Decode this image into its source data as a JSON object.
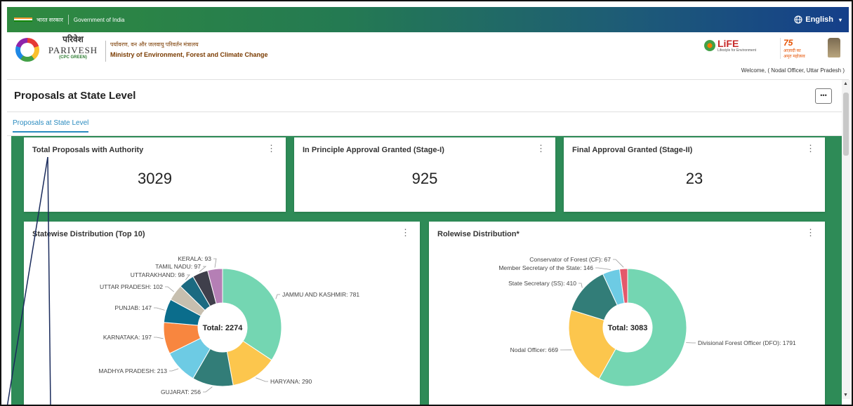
{
  "gov_bar": {
    "hindi_label": "भारत सरकार",
    "label": "Government of India",
    "language": "English",
    "colors": {
      "flag_saffron": "#ff9933",
      "flag_white": "#ffffff",
      "flag_green": "#138808"
    }
  },
  "header": {
    "brand_hindi": "परिवेश",
    "brand_name": "PARIVESH",
    "brand_sub": "(CPC GREEN)",
    "ministry_hindi": "पर्यावरण, वन और जलवायु परिवर्तन मंत्रालय",
    "ministry_name": "Ministry of Environment, Forest and Climate Change",
    "life_logo_text": "LiFE",
    "life_logo_sub": "Lifestyle for Environment",
    "azadi_text": "75",
    "azadi_sub": "आज़ादी का अमृत महोत्सव",
    "welcome": "Welcome, ( Nodal Officer, Uttar Pradesh )"
  },
  "page": {
    "title": "Proposals at State Level",
    "more_icon": "ellipsis-icon",
    "tabs": [
      {
        "label": "Proposals at State Level",
        "active": true
      }
    ]
  },
  "stats": [
    {
      "title": "Total Proposals with Authority",
      "value": "3029"
    },
    {
      "title": "In Principle Approval Granted (Stage-I)",
      "value": "925"
    },
    {
      "title": "Final Approval Granted (Stage-II)",
      "value": "23"
    }
  ],
  "charts": {
    "statewise_title": "Statewise Distribution (Top 10)",
    "rolewise_title": "Rolewise Distribution*"
  },
  "chart_data": [
    {
      "type": "pie",
      "title": "Statewise Distribution (Top 10)",
      "center_label": "Total: 2274",
      "total": 2274,
      "categories": [
        "JAMMU AND KASHMIR",
        "HARYANA",
        "GUJARAT",
        "MADHYA PRADESH",
        "KARNATAKA",
        "PUNJAB",
        "UTTAR PRADESH",
        "UTTARAKHAND",
        "TAMIL NADU",
        "KERALA"
      ],
      "values": [
        781,
        290,
        256,
        213,
        197,
        147,
        102,
        98,
        97,
        93
      ],
      "colors": [
        "#74d6b2",
        "#fcc64d",
        "#327d78",
        "#6dcbe4",
        "#f8863f",
        "#0b6d8c",
        "#c7bfaf",
        "#1b6a81",
        "#3f3f4b",
        "#b57fb5"
      ],
      "labels": [
        "JAMMU AND KASHMIR: 781",
        "HARYANA: 290",
        "GUJARAT: 256",
        "MADHYA PRADESH: 213",
        "KARNATAKA: 197",
        "PUNJAB: 147",
        "UTTAR PRADESH: 102",
        "UTTARAKHAND: 98",
        "TAMIL NADU: 97",
        "KERALA: 93"
      ]
    },
    {
      "type": "pie",
      "title": "Rolewise Distribution*",
      "center_label": "Total: 3083",
      "total": 3083,
      "categories": [
        "Divisional Forest Officer (DFO)",
        "Nodal Officer",
        "State Secretary (SS)",
        "Member Secretary of the State",
        "Conservator of Forest (CF)"
      ],
      "values": [
        1791,
        669,
        410,
        146,
        67
      ],
      "colors": [
        "#74d6b2",
        "#fcc64d",
        "#327d78",
        "#6dcbe4",
        "#e4586b"
      ],
      "labels": [
        "Divisional Forest Officer (DFO): 1791",
        "Nodal Officer: 669",
        "State Secretary (SS): 410",
        "Member Secretary of the State: 146",
        "Conservator of Forest (CF): 67"
      ]
    }
  ]
}
